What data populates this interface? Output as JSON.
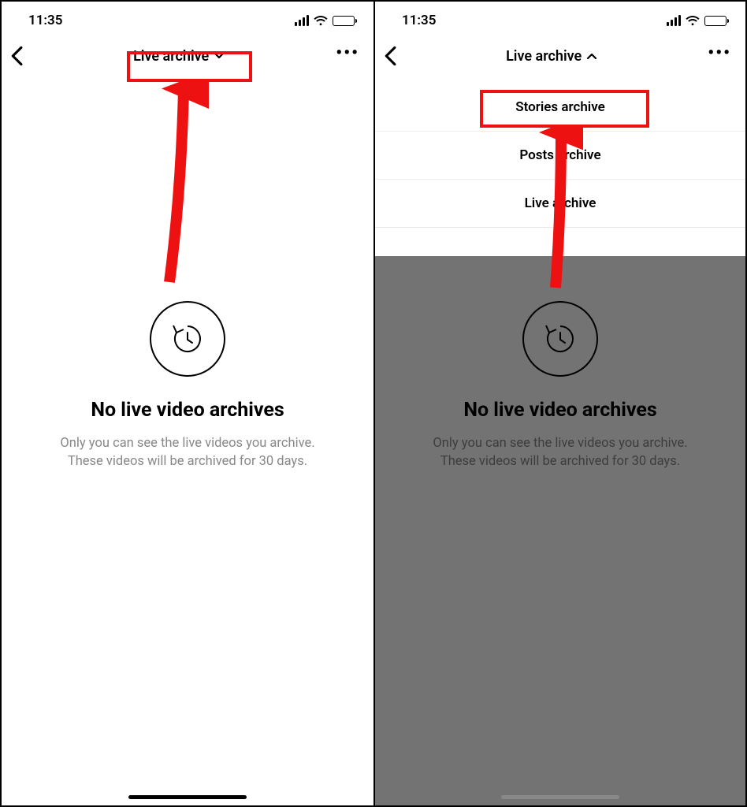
{
  "status": {
    "time": "11:35"
  },
  "nav": {
    "title": "Live archive",
    "more_glyph": "•••"
  },
  "empty": {
    "heading": "No live video archives",
    "line1": "Only you can see the live videos you archive.",
    "line2": "These videos will be archived for 30 days."
  },
  "dropdown": {
    "items": [
      {
        "label": "Stories archive"
      },
      {
        "label": "Posts archive"
      },
      {
        "label": "Live archive"
      }
    ]
  },
  "annotation": {
    "color": "#e11",
    "target_left": "title-dropdown",
    "target_right": "stories-archive-item"
  }
}
